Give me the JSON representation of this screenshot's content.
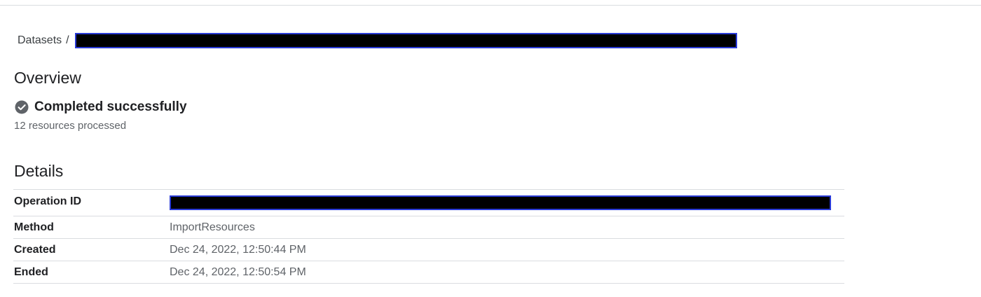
{
  "breadcrumb": {
    "root_label": "Datasets",
    "separator": "/"
  },
  "overview": {
    "title": "Overview",
    "status_label": "Completed successfully",
    "status_icon": "check-circle-icon",
    "resources_text": "12 resources processed"
  },
  "details": {
    "title": "Details",
    "rows": [
      {
        "label": "Operation ID",
        "value": ""
      },
      {
        "label": "Method",
        "value": "ImportResources"
      },
      {
        "label": "Created",
        "value": "Dec 24, 2022, 12:50:44 PM"
      },
      {
        "label": "Ended",
        "value": "Dec 24, 2022, 12:50:54 PM"
      }
    ]
  },
  "colors": {
    "redaction_fill": "#000000",
    "redaction_border": "#2a3bd6",
    "status_icon": "#5f6368",
    "divider": "#dadce0"
  }
}
